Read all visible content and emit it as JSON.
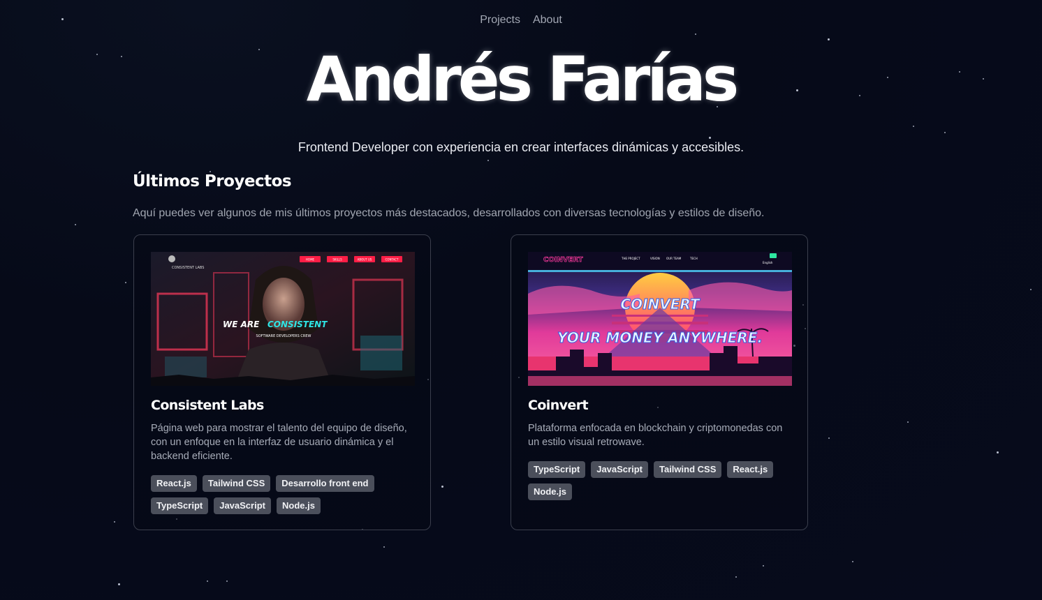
{
  "nav": {
    "projects": "Projects",
    "about": "About"
  },
  "hero": {
    "name": "Andrés Farías",
    "tagline": "Frontend Developer con experiencia en crear interfaces dinámicas y accesibles."
  },
  "projects_section": {
    "title": "Últimos Proyectos",
    "subtitle": "Aquí puedes ver algunos de mis últimos proyectos más destacados, desarrollados con diversas tecnologías y estilos de diseño."
  },
  "projects": [
    {
      "title": "Consistent Labs",
      "description": "Página web para mostrar el talento del equipo de diseño, con un enfoque en la interfaz de usuario dinámica y el backend eficiente.",
      "tags": [
        "React.js",
        "Tailwind CSS",
        "Desarrollo front end",
        "TypeScript",
        "JavaScript",
        "Node.js"
      ],
      "thumb": {
        "brand": "CONSISTENT LABS",
        "nav": [
          "HOME",
          "SKILLS",
          "ABOUT US",
          "CONTACT"
        ],
        "headline_a": "WE ARE",
        "headline_b": "CONSISTENT",
        "tagline": "SOFTWARE DEVELOPERS CREW"
      }
    },
    {
      "title": "Coinvert",
      "description": "Plataforma enfocada en blockchain y criptomonedas con un estilo visual retrowave.",
      "tags": [
        "TypeScript",
        "JavaScript",
        "Tailwind CSS",
        "React.js",
        "Node.js"
      ],
      "thumb": {
        "brand": "COINVERT",
        "nav": [
          "THE PROJECT",
          "VISION",
          "OUR TEAM",
          "TECH"
        ],
        "lang": "English",
        "headline_a": "COINVERT",
        "headline_b": "YOUR MONEY ANYWHERE."
      }
    }
  ],
  "colors": {
    "background": "#070b1c",
    "tag_bg": "#4b4f5b",
    "accent_cyan": "#2ee6e6",
    "accent_pink": "#ff2d78"
  }
}
